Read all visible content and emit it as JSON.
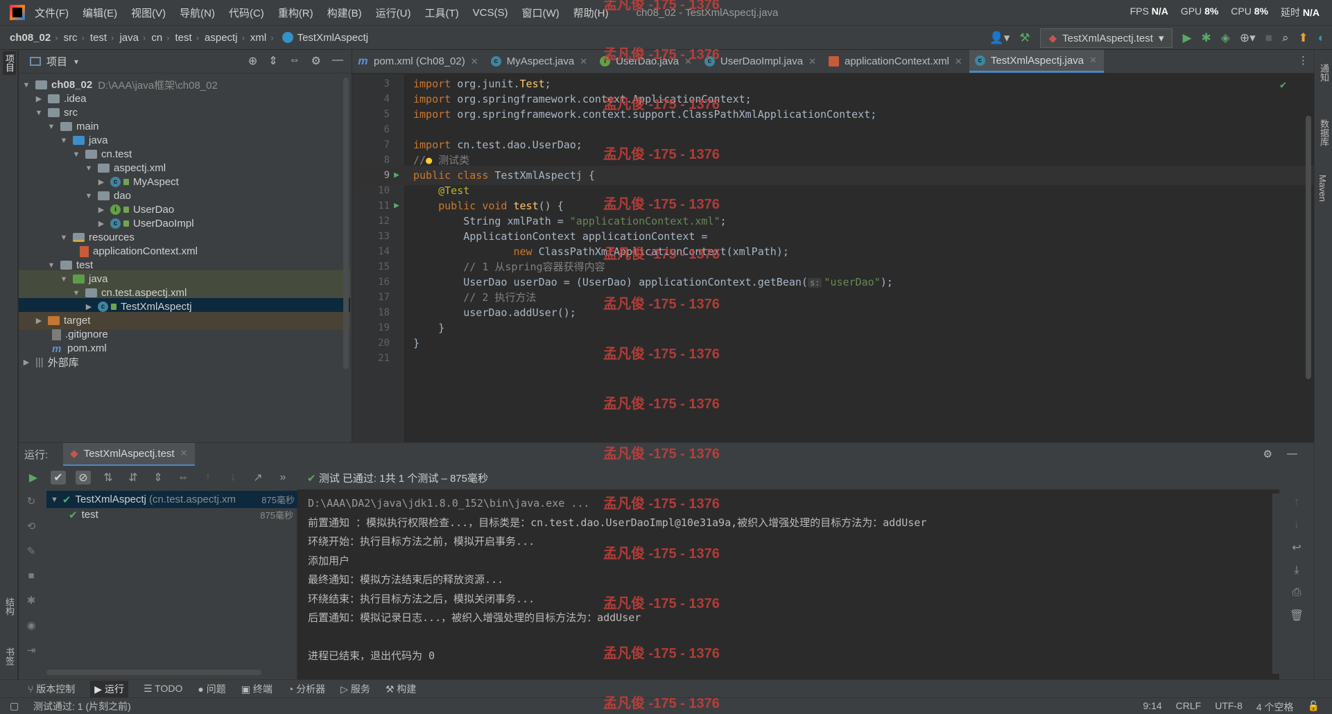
{
  "menu": {
    "items": [
      "文件(F)",
      "编辑(E)",
      "视图(V)",
      "导航(N)",
      "代码(C)",
      "重构(R)",
      "构建(B)",
      "运行(U)",
      "工具(T)",
      "VCS(S)",
      "窗口(W)",
      "帮助(H)"
    ],
    "window_title": "ch08_02 - TestXmlAspectj.java",
    "perf": {
      "fps_label": "FPS",
      "fps": "N/A",
      "gpu_label": "GPU",
      "gpu": "8%",
      "cpu_label": "CPU",
      "cpu": "8%",
      "delay_label": "延时",
      "delay": "N/A"
    }
  },
  "breadcrumb": [
    "ch08_02",
    "src",
    "test",
    "java",
    "cn",
    "test",
    "aspectj",
    "xml",
    "TestXmlAspectj"
  ],
  "run_config": "TestXmlAspectj.test",
  "left_stripe": {
    "project": "项目",
    "structure": "结构",
    "bookmarks": "书签"
  },
  "right_stripe": {
    "notifications": "通知",
    "database": "数据库",
    "maven": "Maven"
  },
  "project_panel": {
    "title": "项目",
    "tree": [
      {
        "label": "ch08_02",
        "path": "D:\\AAA\\java框架\\ch08_02"
      },
      {
        "label": ".idea"
      },
      {
        "label": "src"
      },
      {
        "label": "main"
      },
      {
        "label": "java"
      },
      {
        "label": "cn.test"
      },
      {
        "label": "aspectj.xml"
      },
      {
        "label": "MyAspect"
      },
      {
        "label": "dao"
      },
      {
        "label": "UserDao"
      },
      {
        "label": "UserDaoImpl"
      },
      {
        "label": "resources"
      },
      {
        "label": "applicationContext.xml"
      },
      {
        "label": "test"
      },
      {
        "label": "java"
      },
      {
        "label": "cn.test.aspectj.xml"
      },
      {
        "label": "TestXmlAspectj"
      },
      {
        "label": "target"
      },
      {
        "label": ".gitignore"
      },
      {
        "label": "pom.xml"
      },
      {
        "label": "外部库"
      }
    ]
  },
  "editor_tabs": [
    {
      "label": "pom.xml (Ch08_02)",
      "icon": "m"
    },
    {
      "label": "MyAspect.java",
      "icon": "c"
    },
    {
      "label": "UserDao.java",
      "icon": "i"
    },
    {
      "label": "UserDaoImpl.java",
      "icon": "c"
    },
    {
      "label": "applicationContext.xml",
      "icon": "xml"
    },
    {
      "label": "TestXmlAspectj.java",
      "icon": "c",
      "active": true
    }
  ],
  "code": {
    "line_numbers": [
      "3",
      "4",
      "5",
      "6",
      "7",
      "8",
      "9",
      "10",
      "11",
      "12",
      "13",
      "14",
      "15",
      "16",
      "17",
      "18",
      "19",
      "20",
      "21"
    ],
    "l3": {
      "kw": "import",
      "rest": " org.junit.",
      "cls": "Test",
      "end": ";"
    },
    "l4": {
      "kw": "import",
      "rest": " org.springframework.context.ApplicationContext;"
    },
    "l5": {
      "kw": "import",
      "rest": " org.springframework.context.support.ClassPathXmlApplicationContext;"
    },
    "l7": {
      "kw": "import",
      "rest": " cn.test.dao.UserDao;"
    },
    "l8": {
      "cmt": "//",
      "cmt_text": " 测试类"
    },
    "l9": {
      "kw": "public class",
      "rest": " TestXmlAspectj {"
    },
    "l10": {
      "ann": "@Test"
    },
    "l11": {
      "kw": "public void",
      "fn": "test",
      "rest": "() {"
    },
    "l12": {
      "rest": "String xmlPath = ",
      "str": "\"applicationContext.xml\"",
      "end": ";"
    },
    "l13": {
      "rest": "ApplicationContext applicationContext ="
    },
    "l14": {
      "kw": "new",
      "rest": " ClassPathXmlApplicationContext(xmlPath);"
    },
    "l15": {
      "cmt": "// 1 从spring容器获得内容"
    },
    "l16": {
      "rest": "UserDao userDao = (UserDao) applicationContext.getBean(",
      "hint": "s:",
      "str": "\"userDao\"",
      "end": ");"
    },
    "l17": {
      "cmt": "// 2 执行方法"
    },
    "l18": {
      "rest": "userDao.addUser();"
    },
    "l19": {
      "rest": "}"
    },
    "l20": {
      "rest": "}"
    }
  },
  "run_panel": {
    "label": "运行:",
    "tab": "TestXmlAspectj.test",
    "status_prefix": "测试 已通过:",
    "status_count": "1共 1 个测试 – 875毫秒",
    "tests": [
      {
        "name": "TestXmlAspectj",
        "detail": "(cn.test.aspectj.xm",
        "time": "875毫秒"
      },
      {
        "name": "test",
        "time": "875毫秒"
      }
    ],
    "console": [
      "D:\\AAA\\DA2\\java\\jdk1.8.0_152\\bin\\java.exe ...",
      "前置通知 ：模拟执行权限检查...，目标类是：cn.test.dao.UserDaoImpl@10e31a9a,被织入增强处理的目标方法为：addUser",
      "环绕开始：执行目标方法之前，模拟开启事务...",
      "添加用户",
      "最终通知：模拟方法结束后的释放资源...",
      "环绕结束：执行目标方法之后，模拟关闭事务...",
      "后置通知：模拟记录日志...，被织入增强处理的目标方法为：addUser",
      "",
      "进程已结束，退出代码为 0"
    ]
  },
  "tool_windows": [
    "版本控制",
    "运行",
    "TODO",
    "问题",
    "终端",
    "分析器",
    "服务",
    "构建"
  ],
  "status_bar": {
    "message": "测试通过: 1 (片刻之前)",
    "position": "9:14",
    "line_sep": "CRLF",
    "encoding": "UTF-8",
    "indent": "4 个空格"
  },
  "watermark": "孟凡俊 -175 - 1376"
}
